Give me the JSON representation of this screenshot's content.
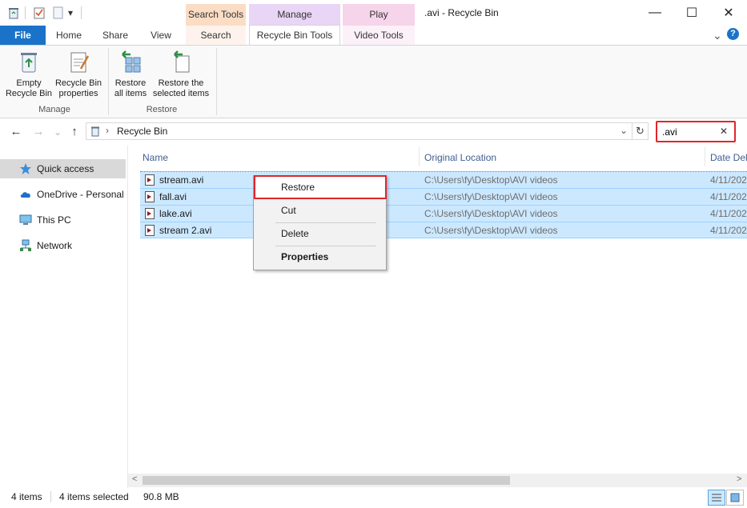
{
  "window": {
    "title": ".avi - Recycle Bin",
    "minimize_glyph": "—",
    "maximize_glyph": "☐",
    "close_glyph": "✕"
  },
  "quick_access_toolbar": {
    "dropdown_glyph": "▾",
    "icons": [
      "recycle-bin-icon",
      "properties-icon",
      "new-folder-icon"
    ]
  },
  "context_tab_groups": [
    {
      "name": "Search Tools",
      "color": "#fbdcc5"
    },
    {
      "name": "Manage",
      "color": "#e9d5f5"
    },
    {
      "name": "Play",
      "color": "#f6d4ea"
    }
  ],
  "tabs": {
    "file": "File",
    "home": "Home",
    "share": "Share",
    "view": "View",
    "search": "Search",
    "recycle_bin_tools": "Recycle Bin Tools",
    "video_tools": "Video Tools"
  },
  "ribbon": {
    "expand_glyph": "⌄",
    "help_glyph": "?",
    "manage_group": {
      "label": "Manage",
      "empty_line1": "Empty",
      "empty_line2": "Recycle Bin",
      "props_line1": "Recycle Bin",
      "props_line2": "properties"
    },
    "restore_group": {
      "label": "Restore",
      "all_line1": "Restore",
      "all_line2": "all items",
      "sel_line1": "Restore the",
      "sel_line2": "selected items"
    }
  },
  "navigation": {
    "back_glyph": "←",
    "forward_glyph": "→",
    "recent_glyph": "⌄",
    "up_glyph": "↑",
    "breadcrumb_sep": "›",
    "location": "Recycle Bin",
    "address_dropdown_glyph": "⌄",
    "refresh_glyph": "↻"
  },
  "search": {
    "value": ".avi",
    "clear_glyph": "✕"
  },
  "nav_pane": {
    "items": [
      {
        "label": "Quick access",
        "icon": "star-icon",
        "selected": true
      },
      {
        "label": "OneDrive - Personal",
        "icon": "cloud-icon",
        "selected": false
      },
      {
        "label": "This PC",
        "icon": "computer-icon",
        "selected": false
      },
      {
        "label": "Network",
        "icon": "network-icon",
        "selected": false
      }
    ]
  },
  "file_list": {
    "columns": [
      "Name",
      "Original Location",
      "Date Del"
    ],
    "rows": [
      {
        "name": "stream.avi",
        "location": "C:\\Users\\fy\\Desktop\\AVI videos",
        "date": "4/11/202"
      },
      {
        "name": "fall.avi",
        "location": "C:\\Users\\fy\\Desktop\\AVI videos",
        "date": "4/11/202"
      },
      {
        "name": "lake.avi",
        "location": "C:\\Users\\fy\\Desktop\\AVI videos",
        "date": "4/11/202"
      },
      {
        "name": "stream 2.avi",
        "location": "C:\\Users\\fy\\Desktop\\AVI videos",
        "date": "4/11/202"
      }
    ]
  },
  "context_menu": {
    "items": [
      "Restore",
      "Cut",
      "Delete",
      "Properties"
    ]
  },
  "scrollbar": {
    "left_glyph": "<",
    "right_glyph": ">"
  },
  "status_bar": {
    "item_count": "4 items",
    "selected": "4 items selected",
    "size": "90.8 MB"
  },
  "colors": {
    "accent": "#1a73c8",
    "selection": "#cce8ff",
    "highlight_outline": "#e0262a"
  }
}
